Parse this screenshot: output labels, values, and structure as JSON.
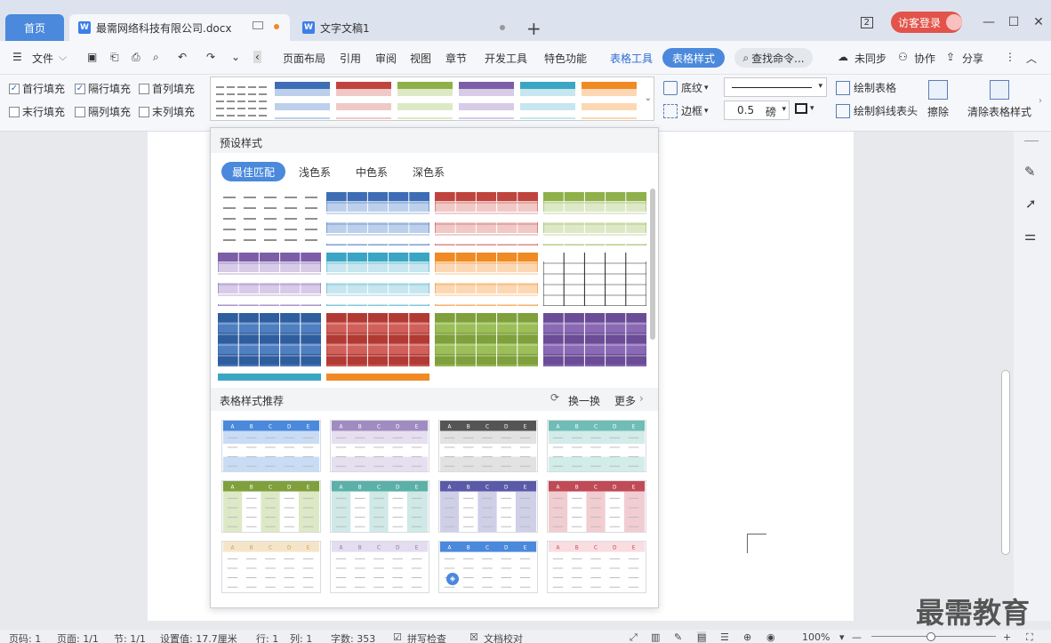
{
  "tabs": {
    "home": "首页",
    "doc1": "最需网络科技有限公司.docx",
    "doc2": "文字文稿1",
    "new": "+"
  },
  "titlebar": {
    "page_badge": "2",
    "login": "访客登录",
    "minimize": "—",
    "maximize": "☐",
    "close": "✕"
  },
  "menu": {
    "file": "文件",
    "items": [
      "页面布局",
      "引用",
      "审阅",
      "视图",
      "章节",
      "开发工具",
      "特色功能"
    ],
    "table_tools": "表格工具",
    "table_style": "表格样式",
    "search": "查找命令...",
    "unsync": "未同步",
    "collab": "协作",
    "share": "分享"
  },
  "ribbon": {
    "checkboxes": [
      {
        "label": "首行填充",
        "checked": true
      },
      {
        "label": "隔行填充",
        "checked": true
      },
      {
        "label": "首列填充",
        "checked": false
      },
      {
        "label": "末行填充",
        "checked": false
      },
      {
        "label": "隔列填充",
        "checked": false
      },
      {
        "label": "末列填充",
        "checked": false
      }
    ],
    "shading": "底纹",
    "border": "边框",
    "line_width": "0.5",
    "unit": "磅",
    "draw_table": "绘制表格",
    "draw_diag": "绘制斜线表头",
    "erase": "擦除",
    "clear_style": "清除表格样式"
  },
  "panel": {
    "title": "预设样式",
    "filters": [
      "最佳匹配",
      "浅色系",
      "中色系",
      "深色系"
    ],
    "rec_title": "表格样式推荐",
    "refresh": "换一换",
    "more": "更多",
    "headers": [
      "A",
      "B",
      "C",
      "D",
      "E"
    ]
  },
  "status": {
    "page": "页码: 1",
    "pages": "页面: 1/1",
    "section": "节: 1/1",
    "setting": "设置值: 17.7厘米",
    "row": "行: 1",
    "col": "列: 1",
    "words": "字数: 353",
    "spell": "拼写检查",
    "proof": "文档校对",
    "zoom": "100%"
  },
  "watermark": "最需教育",
  "colors": {
    "accent": "#4a89dc",
    "login": "#e2534a"
  }
}
